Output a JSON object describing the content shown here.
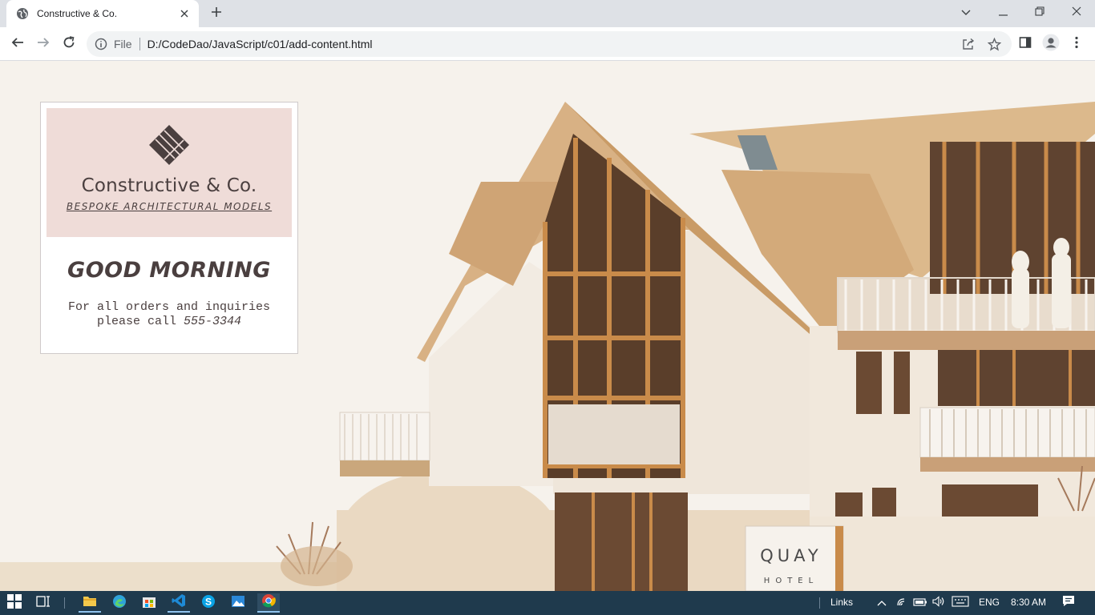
{
  "browser": {
    "tab": {
      "title": "Constructive & Co.",
      "favicon": "globe-icon",
      "close_icon": "close-icon"
    },
    "new_tab_icon": "plus-icon",
    "window_controls": [
      "chevron-down-icon",
      "minimize-icon",
      "restore-icon",
      "close-icon"
    ],
    "toolbar": {
      "back_icon": "back-arrow-icon",
      "forward_icon": "forward-arrow-icon",
      "reload_icon": "reload-icon",
      "omnibox": {
        "scheme": "File",
        "url": "D:/CodeDao/JavaScript/c01/add-content.html",
        "actions": [
          "share-icon",
          "star-icon"
        ]
      },
      "right_icons": [
        "side-panel-icon",
        "profile-icon",
        "kebab-menu-icon"
      ]
    }
  },
  "page": {
    "card": {
      "logo": "diamond-logo-icon",
      "brand_name": "Constructive & Co.",
      "tagline": "BESPOKE ARCHITECTURAL MODELS",
      "greeting": "GOOD MORNING",
      "contact_line1": "For all orders and inquiries",
      "contact_line2_prefix": "please call ",
      "phone": "555-3344"
    },
    "hero_image": {
      "sign_title": "QUAY",
      "sign_subtitle": "HOTEL"
    }
  },
  "taskbar": {
    "apps": [
      "windows-start-icon",
      "task-view-icon",
      "file-explorer-icon",
      "edge-icon",
      "store-icon",
      "vscode-icon",
      "skype-icon",
      "photos-icon",
      "chrome-icon"
    ],
    "links_label": "Links",
    "language": "ENG",
    "time": "8:30 AM",
    "tray_icons": [
      "chevron-up-icon",
      "wifi-icon",
      "battery-icon",
      "volume-icon",
      "keyboard-icon",
      "notification-icon"
    ]
  },
  "colors": {
    "card_header_bg": "#efdcd8",
    "text_dark": "#4a3f3f",
    "page_bg": "#f6f2ec",
    "taskbar_bg": "#1f3a4d"
  }
}
